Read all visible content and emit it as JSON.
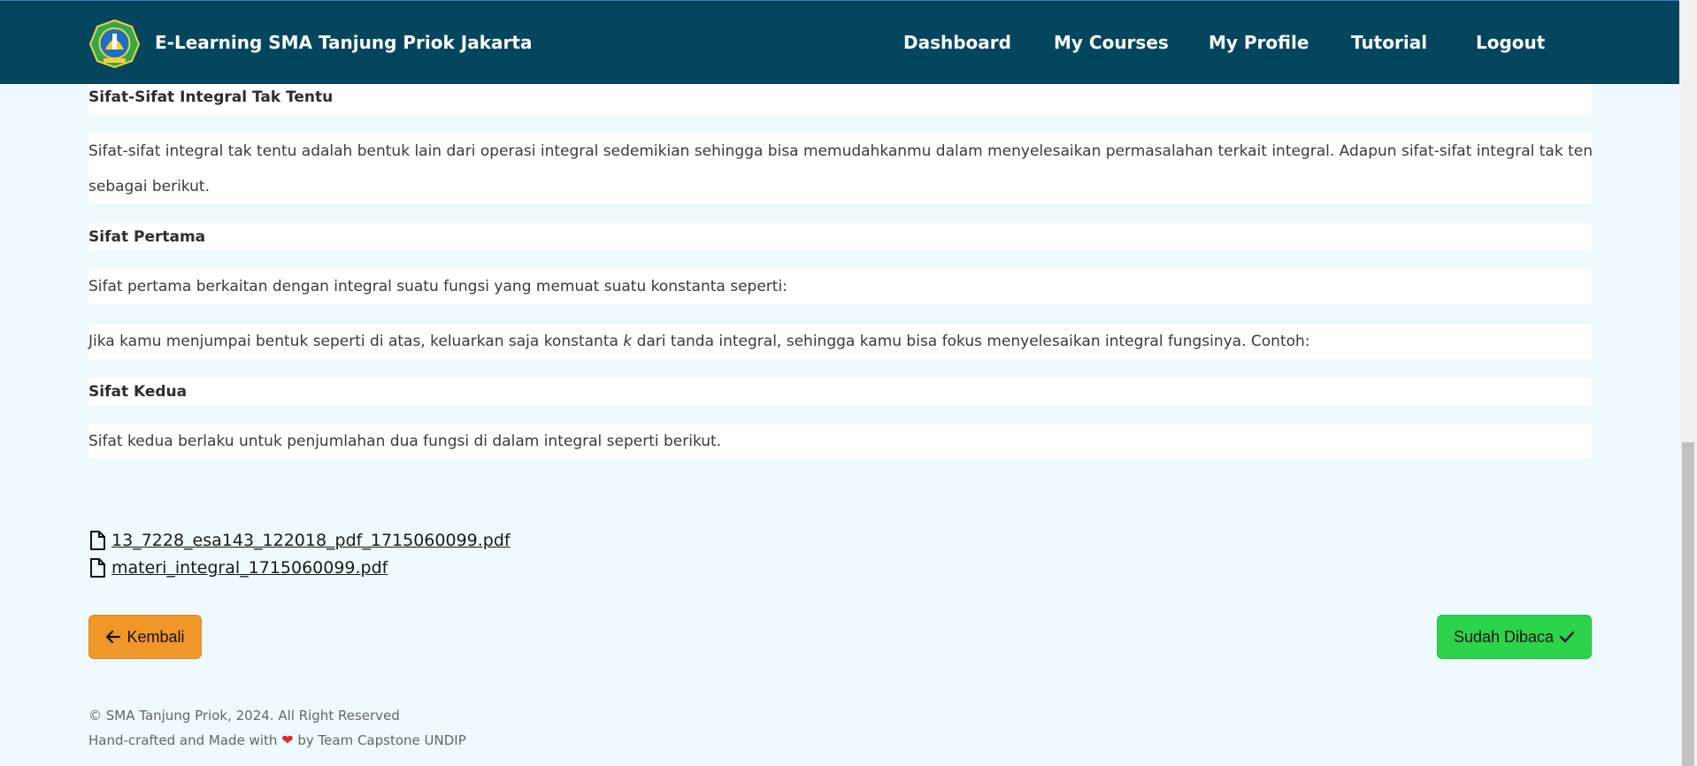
{
  "nav": {
    "brand": "E-Learning SMA Tanjung Priok Jakarta",
    "links": [
      "Dashboard",
      "My Courses",
      "My Profile",
      "Tutorial",
      "Logout"
    ]
  },
  "content": {
    "heading1": "Sifat-Sifat Integral Tak Tentu",
    "para1_line1": "Sifat-sifat integral tak tentu adalah bentuk lain dari operasi integral sedemikian sehingga bisa memudahkanmu dalam menyelesaikan permasalahan terkait integral. Adapun sifat-sifat integral tak tentu adalah",
    "para1_line2": "sebagai berikut.",
    "heading2": "Sifat Pertama",
    "para2": "Sifat pertama berkaitan dengan integral suatu fungsi yang memuat suatu konstanta seperti:",
    "para3_a": "Jika kamu menjumpai bentuk seperti di atas, keluarkan saja konstanta ",
    "para3_k": "k",
    "para3_b": " dari tanda integral, sehingga kamu bisa fokus menyelesaikan integral fungsinya. Contoh:",
    "heading3": "Sifat Kedua",
    "para4": "Sifat kedua berlaku untuk penjumlahan dua fungsi di dalam integral seperti berikut."
  },
  "files": [
    "13_7228_esa143_122018_pdf_1715060099.pdf",
    "materi_integral_1715060099.pdf"
  ],
  "actions": {
    "back": "Kembali",
    "read": "Sudah Dibaca"
  },
  "footer": {
    "copyright": "© SMA Tanjung Priok, 2024. All Right Reserved",
    "made_a": "Hand-crafted and Made with",
    "made_b": "by Team Capstone UNDIP"
  },
  "colors": {
    "nav": "#03465e",
    "back_button": "#f0972a",
    "read_button": "#2bd44a",
    "page_bg": "#eefafd"
  }
}
